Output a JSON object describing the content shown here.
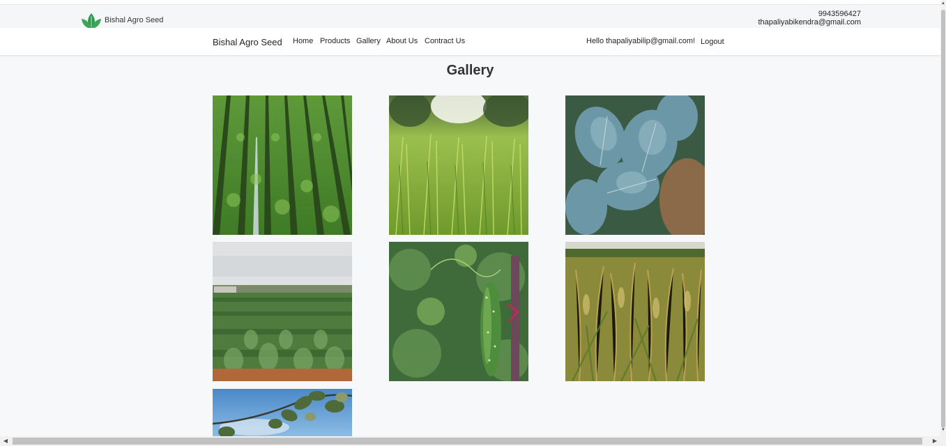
{
  "topbar": {
    "brand": "Bishal Agro Seed",
    "phone": "9943596427",
    "email": "thapaliyabikendra@gmail.com",
    "logo_icon": "leaf-logo-icon"
  },
  "navbar": {
    "brand": "Bishal Agro Seed",
    "links": [
      "Home",
      "Products",
      "Gallery",
      "About Us",
      "Contract Us"
    ],
    "greeting": "Hello thapaliyabilip@gmail.com!",
    "logout": "Logout"
  },
  "page": {
    "title": "Gallery",
    "images": [
      "lettuce-field-rows-image",
      "green-wheat-grass-image",
      "cabbage-plant-image",
      "leafy-crop-field-image",
      "cucumber-vine-image",
      "rice-paddy-image",
      "tree-branch-sky-image"
    ]
  },
  "colors": {
    "background": "#f7f8f9",
    "navbar": "#ffffff",
    "logo_green": "#2e9c4c"
  }
}
